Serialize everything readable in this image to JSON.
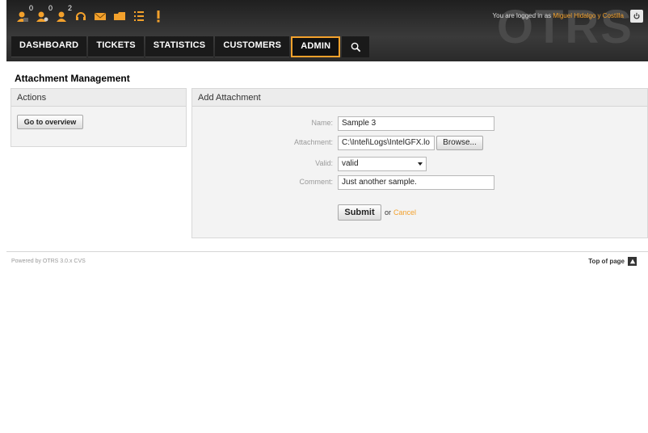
{
  "header": {
    "logo_text": "OTRS",
    "login_prefix": "You are logged in as",
    "user_name": "Miguel Hidalgo y Costilla",
    "toolbar": [
      {
        "icon": "locked-tickets-icon",
        "count": "0"
      },
      {
        "icon": "watched-tickets-icon",
        "count": "0"
      },
      {
        "icon": "responsible-tickets-icon",
        "count": "2"
      },
      {
        "icon": "new-phone-ticket-icon",
        "count": ""
      },
      {
        "icon": "new-email-ticket-icon",
        "count": ""
      },
      {
        "icon": "ticket-queue-icon",
        "count": ""
      },
      {
        "icon": "ticket-status-icon",
        "count": ""
      },
      {
        "icon": "escalation-icon",
        "count": ""
      }
    ]
  },
  "nav": {
    "items": [
      "DASHBOARD",
      "TICKETS",
      "STATISTICS",
      "CUSTOMERS",
      "ADMIN"
    ],
    "active": "ADMIN"
  },
  "page": {
    "title": "Attachment Management"
  },
  "actions": {
    "header": "Actions",
    "goto_label": "Go to overview"
  },
  "form": {
    "header": "Add Attachment",
    "name_label": "Name:",
    "name_value": "Sample 3",
    "attachment_label": "Attachment:",
    "attachment_value": "C:\\Intel\\Logs\\IntelGFX.lo",
    "browse_label": "Browse...",
    "valid_label": "Valid:",
    "valid_value": "valid",
    "comment_label": "Comment:",
    "comment_value": "Just another sample.",
    "submit_label": "Submit",
    "or_text": "or",
    "cancel_label": "Cancel"
  },
  "footer": {
    "powered_by": "Powered by OTRS 3.0.x CVS",
    "top_of_page": "Top of page"
  },
  "colors": {
    "accent": "#f3a12c",
    "header_bg": "#2a2a2a"
  }
}
